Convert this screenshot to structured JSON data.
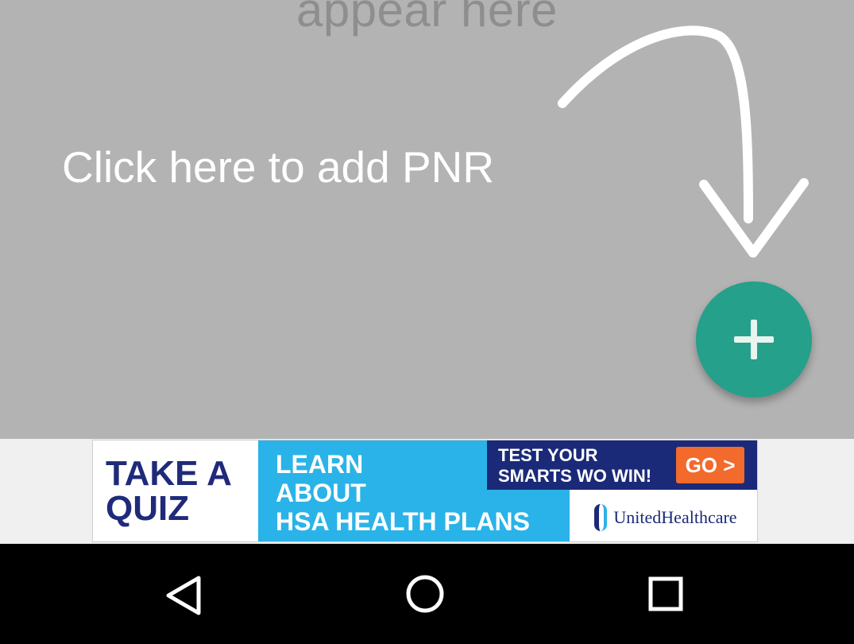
{
  "overlay": {
    "empty_text": "appear here",
    "hint_text": "Click here to add PNR",
    "arrow_icon": "curved-arrow-icon",
    "background_color": "#b3b3b3"
  },
  "fab": {
    "icon": "plus-icon",
    "color": "#25a08a"
  },
  "ad": {
    "left_text_line1": "TAKE A",
    "left_text_line2": "QUIZ",
    "middle_line1": "LEARN",
    "middle_line2": "ABOUT",
    "middle_line3": "HSA HEALTH PLANS",
    "top_right_line1": "TEST YOUR",
    "top_right_line2": "SMARTS WO WIN!",
    "go_label": "GO >",
    "brand": "UnitedHealthcare",
    "colors": {
      "navy": "#1b2a78",
      "sky": "#2ab3e8",
      "orange": "#f26a2c"
    }
  },
  "navbar": {
    "back_icon": "back-triangle-icon",
    "home_icon": "home-circle-icon",
    "recent_icon": "recent-apps-square-icon"
  }
}
